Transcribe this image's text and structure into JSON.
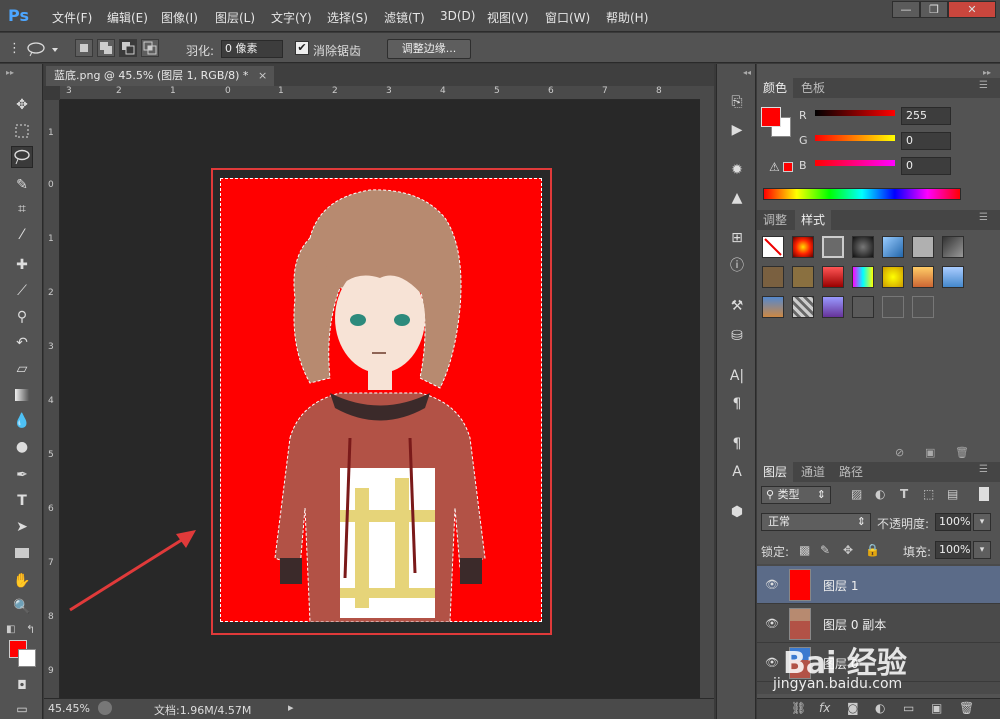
{
  "app": {
    "logo": "Ps"
  },
  "menu": [
    "文件(F)",
    "编辑(E)",
    "图像(I)",
    "图层(L)",
    "文字(Y)",
    "选择(S)",
    "滤镜(T)",
    "3D(D)",
    "视图(V)",
    "窗口(W)",
    "帮助(H)"
  ],
  "window_controls": {
    "minimize": "—",
    "restore": "❐",
    "close": "✕"
  },
  "options": {
    "feather_label": "羽化:",
    "feather_value": "0 像素",
    "antialias_label": "消除锯齿",
    "antialias_checked": true,
    "refine_edge": "调整边缘..."
  },
  "document": {
    "tab_title": "蓝底.png @ 45.5% (图层 1, RGB/8) *",
    "tab_close": "×",
    "hruler_ticks": [
      "3",
      "2",
      "1",
      "0",
      "1",
      "2",
      "3",
      "4",
      "5",
      "6",
      "7",
      "8"
    ],
    "vruler_ticks": [
      "1",
      "0",
      "1",
      "2",
      "3",
      "4",
      "5",
      "6",
      "7",
      "8",
      "9"
    ],
    "zoom": "45.45%",
    "doc_size": "文档:1.96M/4.57M"
  },
  "colors": {
    "foreground": "#ff0000",
    "background": "#ffffff",
    "canvas_fill": "#ff0000",
    "annotation": "#e03a3a"
  },
  "color_panel": {
    "tabs": [
      "颜色",
      "色板"
    ],
    "active_tab": "颜色",
    "r_label": "R",
    "r_value": "255",
    "g_label": "G",
    "g_value": "0",
    "b_label": "B",
    "b_value": "0"
  },
  "styles_panel": {
    "tabs": [
      "调整",
      "样式"
    ],
    "active_tab": "样式"
  },
  "layers_panel": {
    "tabs": [
      "图层",
      "通道",
      "路径"
    ],
    "active_tab": "图层",
    "filter_label": "类型",
    "blend_mode": "正常",
    "opacity_label": "不透明度:",
    "opacity_value": "100%",
    "lock_label": "锁定:",
    "fill_label": "填充:",
    "fill_value": "100%",
    "layers": [
      {
        "name": "图层 1",
        "selected": true
      },
      {
        "name": "图层 0 副本",
        "selected": false
      },
      {
        "name": "图层 0",
        "selected": false
      }
    ]
  },
  "watermark": {
    "brand": "Bai 经验",
    "url": "jingyan.baidu.com"
  }
}
